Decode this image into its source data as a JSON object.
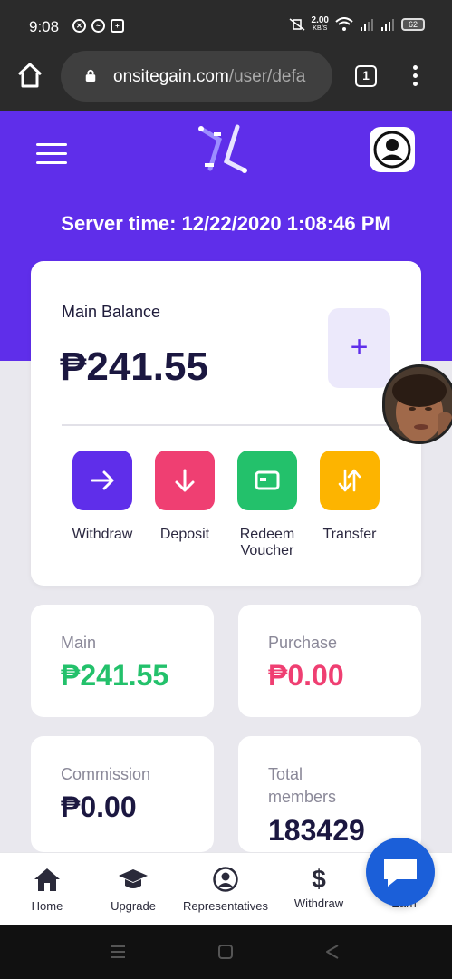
{
  "status_bar": {
    "time": "9:08",
    "net_speed": "2.00",
    "net_unit": "KB/S",
    "battery": "62"
  },
  "browser": {
    "url_host": "onsitegain.com",
    "url_path": "/user/defa",
    "tab_count": "1"
  },
  "header": {
    "server_time": "Server time: 12/22/2020 1:08:46 PM"
  },
  "main_card": {
    "balance_label": "Main Balance",
    "balance_value": "₱241.55",
    "add_label": "+",
    "actions": [
      {
        "label": "Withdraw",
        "color": "#5f2eea",
        "icon": "arrow-right-icon"
      },
      {
        "label": "Deposit",
        "color": "#ef3f72",
        "icon": "arrow-down-icon"
      },
      {
        "label": "Redeem\nVoucher",
        "color": "#23c16b",
        "icon": "card-icon"
      },
      {
        "label": "Transfer",
        "color": "#fdb400",
        "icon": "transfer-arrows-icon"
      }
    ]
  },
  "stats": {
    "main": {
      "label": "Main",
      "value": "₱241.55",
      "color": "#23c16b"
    },
    "purchase": {
      "label": "Purchase",
      "value": "₱0.00",
      "color": "#ef3f72"
    },
    "commission": {
      "label": "Commission",
      "value": "₱0.00",
      "color": "#1b1740"
    },
    "total_members": {
      "label": "Total members",
      "value": "183429",
      "color": "#1b1740"
    }
  },
  "bottom_nav": [
    {
      "label": "Home",
      "icon": "home-icon"
    },
    {
      "label": "Upgrade",
      "icon": "graduation-cap-icon"
    },
    {
      "label": "Representatives",
      "icon": "user-circle-icon"
    },
    {
      "label": "Withdraw",
      "icon": "dollar-icon"
    },
    {
      "label": "Earn",
      "icon": "chat-icon"
    }
  ],
  "colors": {
    "brand": "#5f2eea",
    "chat_fab": "#1b5fd9"
  }
}
